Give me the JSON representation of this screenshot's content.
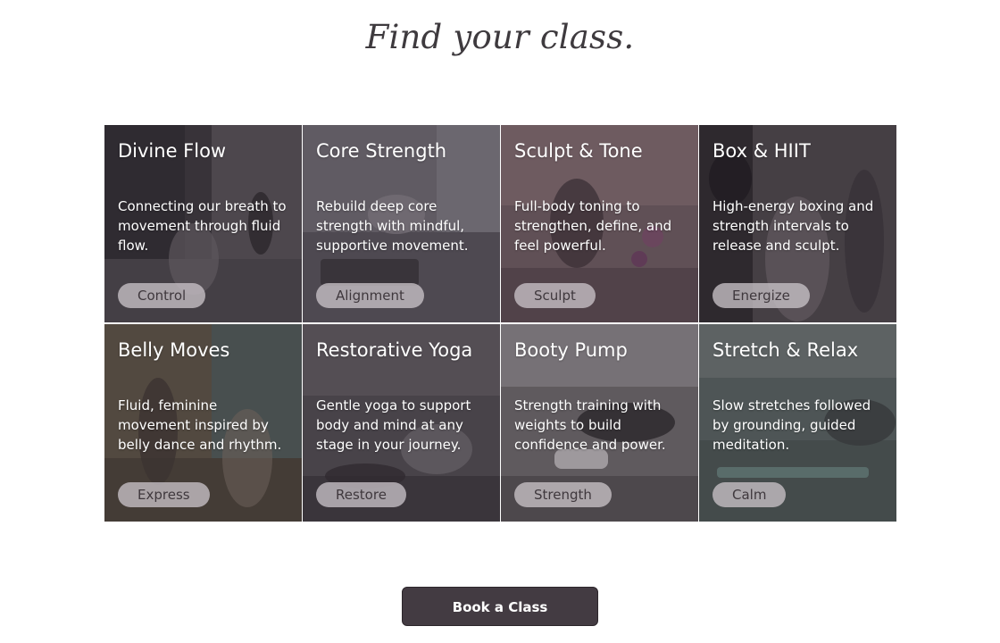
{
  "page": {
    "title": "Find your class."
  },
  "classes": [
    {
      "title": "Divine Flow",
      "desc": "Connecting our breath to movement through fluid flow.",
      "tag": "Control",
      "tone": "#3d3a3f"
    },
    {
      "title": "Core Strength",
      "desc": "Rebuild deep core strength with mindful, supportive movement.",
      "tag": "Alignment",
      "tone": "#6b6870"
    },
    {
      "title": "Sculpt & Tone",
      "desc": "Full-body toning to strengthen, define, and feel powerful.",
      "tag": "Sculpt",
      "tone": "#6e5a5f"
    },
    {
      "title": "Box & HIIT",
      "desc": "High-energy boxing and strength intervals to release and sculpt.",
      "tag": "Energize",
      "tone": "#4a4448"
    },
    {
      "title": "Belly Moves",
      "desc": "Fluid, feminine movement inspired by belly dance and rhythm.",
      "tag": "Express",
      "tone": "#5b5244"
    },
    {
      "title": "Restorative Yoga",
      "desc": "Gentle yoga to support body and mind at any stage in your journey.",
      "tag": "Restore",
      "tone": "#4e4a4f"
    },
    {
      "title": "Booty Pump",
      "desc": "Strength training with weights to build confidence and power.",
      "tag": "Strength",
      "tone": "#6a6669"
    },
    {
      "title": "Stretch & Relax",
      "desc": "Slow stretches followed by grounding, guided meditation.",
      "tag": "Calm",
      "tone": "#56615f"
    }
  ],
  "cta": {
    "label": "Book a Class"
  }
}
